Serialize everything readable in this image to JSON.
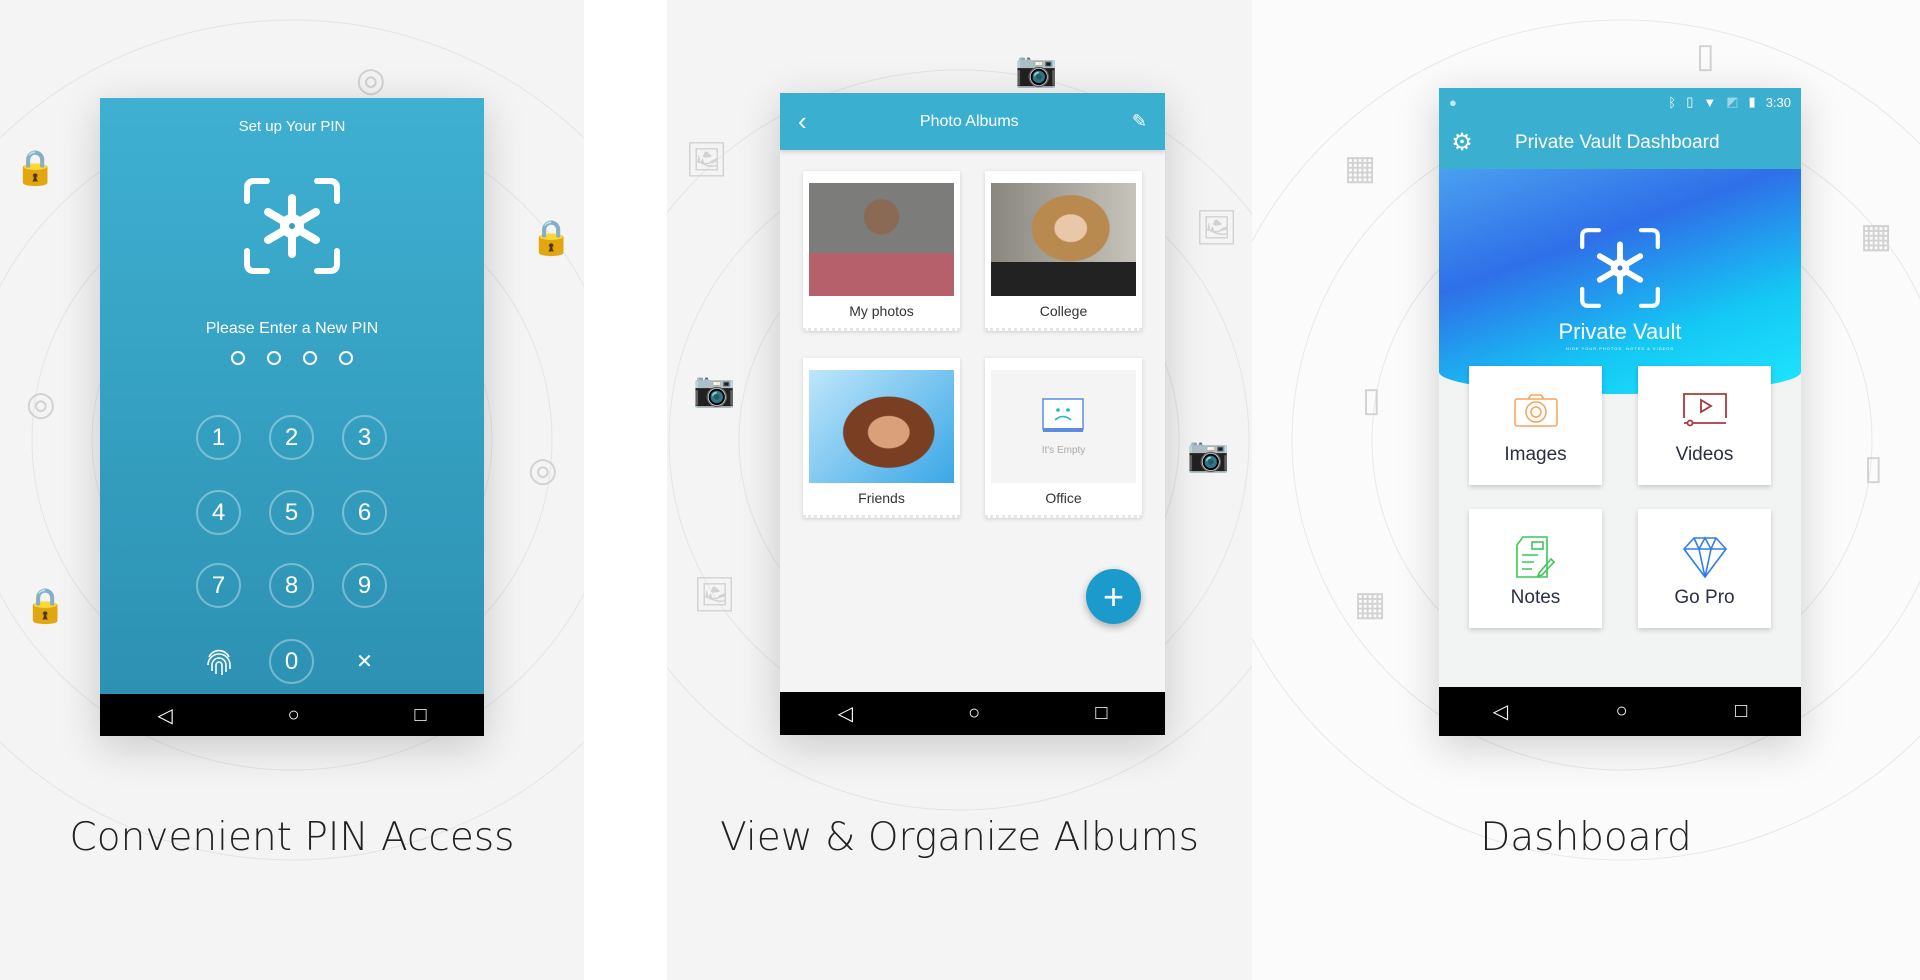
{
  "panels": [
    {
      "caption": "Convenient PIN Access",
      "screen": {
        "title": "Set up Your PIN",
        "prompt": "Please Enter a New PIN",
        "pin_length": 4,
        "keys": [
          "1",
          "2",
          "3",
          "4",
          "5",
          "6",
          "7",
          "8",
          "9",
          "0"
        ],
        "fingerprint_icon": "fingerprint-icon",
        "delete_key": "✕"
      }
    },
    {
      "caption": "View & Organize Albums",
      "screen": {
        "title": "Photo Albums",
        "back_icon": "chevron-left-icon",
        "edit_icon": "pencil-icon",
        "albums": [
          {
            "label": "My photos"
          },
          {
            "label": "College"
          },
          {
            "label": "Friends"
          },
          {
            "label": "Office",
            "empty_text": "It's Empty"
          }
        ],
        "fab": "+"
      }
    },
    {
      "caption": "Dashboard",
      "screen": {
        "time": "3:30",
        "title": "Private Vault Dashboard",
        "brand": "Private Vault",
        "tagline": "HIDE YOUR PHOTOS, NOTES & VIDEOS",
        "tiles": [
          {
            "label": "Images",
            "color": "#f7a35c"
          },
          {
            "label": "Videos",
            "color": "#a83a3a"
          },
          {
            "label": "Notes",
            "color": "#3cc75a"
          },
          {
            "label": "Go Pro",
            "color": "#2f7cf0"
          }
        ]
      }
    }
  ],
  "nav": {
    "back": "◁",
    "home": "○",
    "recents": "□"
  },
  "colors": {
    "accent": "#3aafd0",
    "fab": "#1b9bcc"
  }
}
